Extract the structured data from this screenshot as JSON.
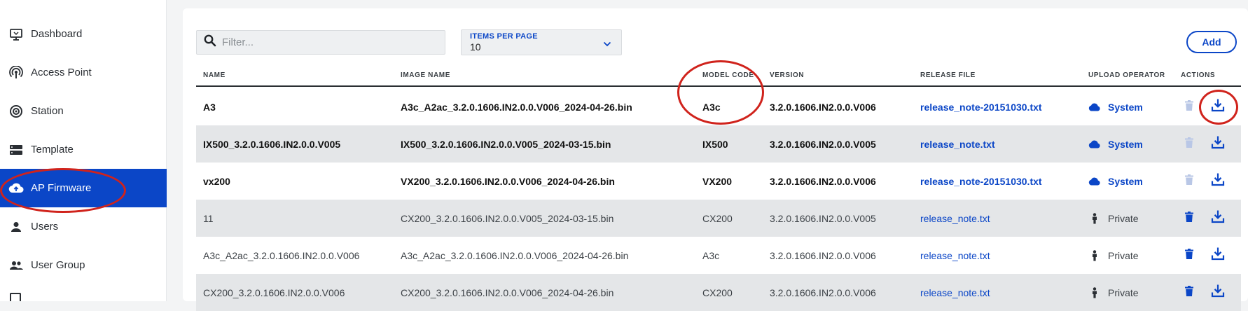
{
  "sidebar": {
    "items": [
      {
        "label": "Dashboard",
        "icon": "monitor-icon"
      },
      {
        "label": "Access Point",
        "icon": "access-point-icon"
      },
      {
        "label": "Station",
        "icon": "station-icon"
      },
      {
        "label": "Template",
        "icon": "template-icon"
      },
      {
        "label": "AP Firmware",
        "icon": "cloud-upload-icon",
        "active": true
      },
      {
        "label": "Users",
        "icon": "user-icon"
      },
      {
        "label": "User Group",
        "icon": "user-group-icon"
      }
    ]
  },
  "toolbar": {
    "filter_placeholder": "Filter...",
    "items_per_page_label": "ITEMS PER PAGE",
    "items_per_page_value": "10",
    "add_label": "Add"
  },
  "table": {
    "columns": [
      "NAME",
      "IMAGE NAME",
      "MODEL CODE",
      "VERSION",
      "RELEASE FILE",
      "UPLOAD OPERATOR",
      "ACTIONS"
    ],
    "rows": [
      {
        "name": "A3",
        "image": "A3c_A2ac_3.2.0.1606.IN2.0.0.V006_2024-04-26.bin",
        "model": "A3c",
        "version": "3.2.0.1606.IN2.0.0.V006",
        "release": "release_note-20151030.txt",
        "operator": "System"
      },
      {
        "name": "IX500_3.2.0.1606.IN2.0.0.V005",
        "image": "IX500_3.2.0.1606.IN2.0.0.V005_2024-03-15.bin",
        "model": "IX500",
        "version": "3.2.0.1606.IN2.0.0.V005",
        "release": "release_note.txt",
        "operator": "System"
      },
      {
        "name": "vx200",
        "image": "VX200_3.2.0.1606.IN2.0.0.V006_2024-04-26.bin",
        "model": "VX200",
        "version": "3.2.0.1606.IN2.0.0.V006",
        "release": "release_note-20151030.txt",
        "operator": "System"
      },
      {
        "name": "11",
        "image": "CX200_3.2.0.1606.IN2.0.0.V005_2024-03-15.bin",
        "model": "CX200",
        "version": "3.2.0.1606.IN2.0.0.V005",
        "release": "release_note.txt",
        "operator": "Private"
      },
      {
        "name": "A3c_A2ac_3.2.0.1606.IN2.0.0.V006",
        "image": "A3c_A2ac_3.2.0.1606.IN2.0.0.V006_2024-04-26.bin",
        "model": "A3c",
        "version": "3.2.0.1606.IN2.0.0.V006",
        "release": "release_note.txt",
        "operator": "Private"
      },
      {
        "name": "CX200_3.2.0.1606.IN2.0.0.V006",
        "image": "CX200_3.2.0.1606.IN2.0.0.V006_2024-04-26.bin",
        "model": "CX200",
        "version": "3.2.0.1606.IN2.0.0.V006",
        "release": "release_note.txt",
        "operator": "Private"
      }
    ]
  },
  "colors": {
    "accent": "#0b46c7",
    "annotation": "#d0231c",
    "row_alt": "#e4e6e8",
    "disabled_delete": "#b9c7e6"
  }
}
